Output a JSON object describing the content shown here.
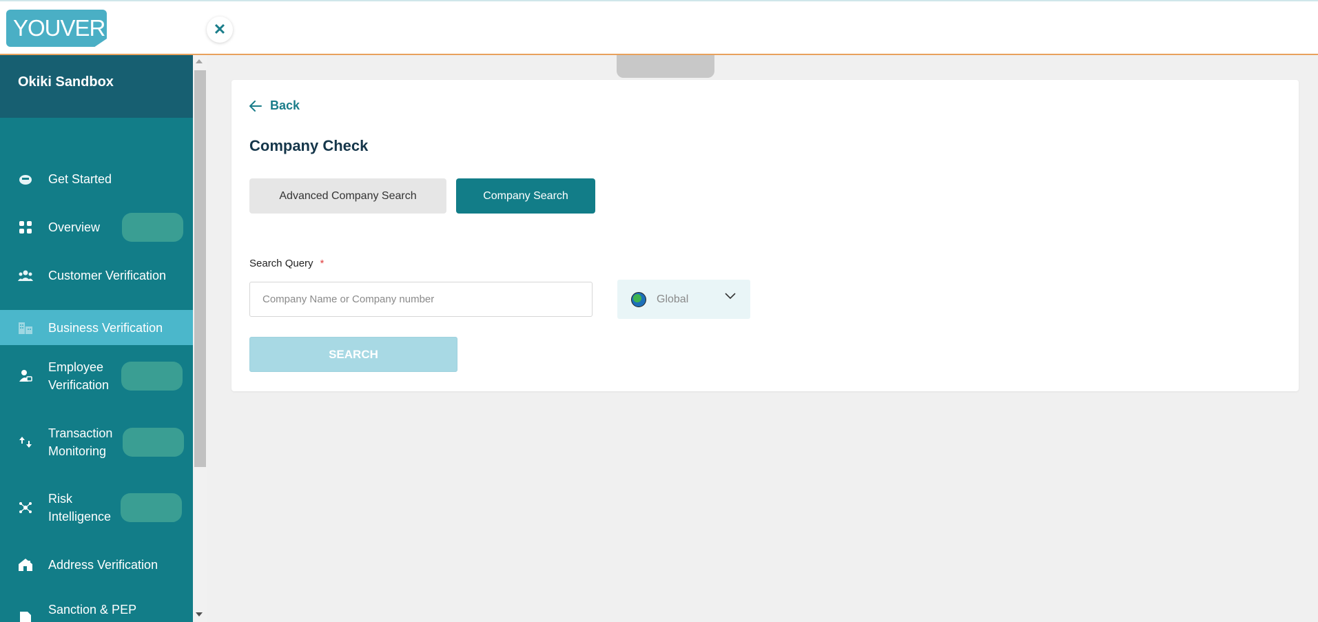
{
  "app": {
    "logo_text": "YOUVERIFY"
  },
  "sidebar": {
    "org_name": "Okiki Sandbox",
    "items": [
      {
        "label": "Get Started",
        "icon": "rocket-icon"
      },
      {
        "label": "Overview",
        "icon": "grid-icon"
      },
      {
        "label": "Customer Verification",
        "icon": "users-icon"
      },
      {
        "label": "Business Verification",
        "icon": "building-icon",
        "active": true
      },
      {
        "label": "Employee Verification",
        "icon": "employee-icon"
      },
      {
        "label": "Transaction Monitoring",
        "icon": "transaction-icon"
      },
      {
        "label": "Risk Intelligence",
        "icon": "risk-icon"
      },
      {
        "label": "Address Verification",
        "icon": "house-icon"
      },
      {
        "label": "Sanction & PEP",
        "icon": "document-icon"
      }
    ]
  },
  "main": {
    "back_label": "Back",
    "title": "Company Check",
    "tabs": [
      {
        "label": "Advanced Company Search",
        "active": false
      },
      {
        "label": "Company Search",
        "active": true
      }
    ],
    "search_query_label": "Search Query",
    "required_mark": "*",
    "search_placeholder": "Company Name or Company number",
    "country_value": "Global",
    "search_button": "SEARCH"
  },
  "colors": {
    "sidebar_bg": "#127d88",
    "sidebar_active": "#4bb7cb",
    "accent": "#127d88",
    "search_button_disabled": "#a8d9e4"
  }
}
